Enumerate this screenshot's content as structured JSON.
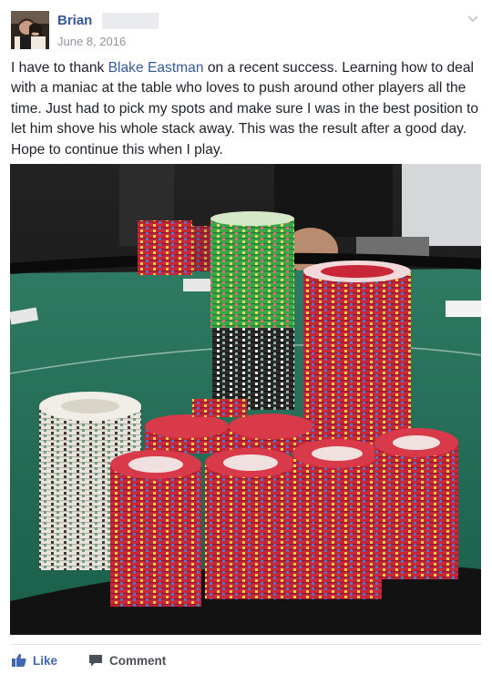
{
  "post": {
    "author_name": "Brian",
    "date": "June 8, 2016",
    "text_before_mention": "I have to thank ",
    "mention": "Blake Eastman",
    "text_after_mention": " on a recent success. Learning how to deal with a maniac at the table who loves to push around other players all the time. Just had to pick my spots and make sure I was in the best position to let him shove his whole stack away. This was the result after a good day. Hope to continue this when I play."
  },
  "actions": {
    "like_label": "Like",
    "comment_label": "Comment"
  },
  "icons": {
    "options": "chevron-down-icon",
    "like": "thumbs-up-icon",
    "comment": "speech-bubble-icon"
  },
  "colors": {
    "link": "#365899",
    "like": "#4267b2",
    "meta": "#90949c",
    "felt": "#1f6b54"
  }
}
